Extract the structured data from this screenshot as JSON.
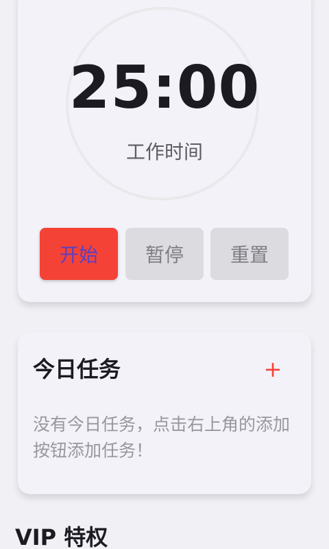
{
  "timer": {
    "time": "25:00",
    "mode": "工作时间",
    "buttons": {
      "start": "开始",
      "pause": "暂停",
      "reset": "重置"
    }
  },
  "tasks": {
    "title": "今日任务",
    "add_icon": "+",
    "empty_text": "没有今日任务，点击右上角的添加按钮添加任务！"
  },
  "vip": {
    "title": "VIP 特权"
  },
  "colors": {
    "accent": "#f44336",
    "start_text": "#5b3fc4",
    "card_bg": "#f3f2f8",
    "page_bg": "#f1f1f5"
  }
}
